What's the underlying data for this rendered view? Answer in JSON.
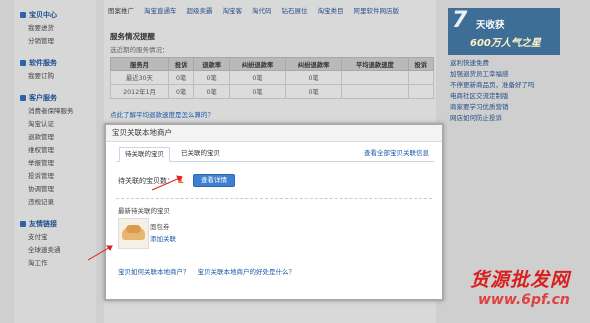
{
  "sidebar": {
    "sections": [
      {
        "title": "宝贝中心",
        "items": [
          "我要进货",
          "分销管理"
        ]
      },
      {
        "title": "软件服务",
        "items": [
          "我要订购"
        ]
      },
      {
        "title": "客户服务",
        "items": [
          "消费者保障服务",
          "淘宝认证",
          "退款管理",
          "维权管理",
          "举报管理",
          "投诉管理",
          "协调管理",
          "违规记录"
        ]
      },
      {
        "title": "友情链接",
        "items": [
          "支付宝",
          "全球速卖通",
          "淘工作"
        ]
      }
    ]
  },
  "main": {
    "tabs": [
      "图案推广",
      "淘宝直通车",
      "超级卖霸",
      "淘宝客",
      "淘代码",
      "钻石展位",
      "淘宝类目",
      "阿里软件网店版"
    ],
    "section_title": "服务情况提醒",
    "section_subtitle": "选近期的服务情况：",
    "table": {
      "headers": [
        "服务月",
        "投诉",
        "退款率",
        "纠纷退款率",
        "纠纷退款率",
        "平均退款速度",
        "投诉"
      ],
      "rows": [
        [
          "最近30天",
          "0笔",
          "0笔",
          "0笔",
          "0笔",
          "",
          ""
        ],
        [
          "2012年1月",
          "0笔",
          "0笔",
          "0笔",
          "0笔",
          "",
          ""
        ]
      ]
    },
    "footer_link": "点此了解平均退款速度是怎么算的？"
  },
  "banner": {
    "big": "7",
    "mid": "天收获",
    "low": "600万人气之星"
  },
  "right_links": [
    "返利快速免费",
    "加强退货员工幸福感",
    "不停更新商品页，准备好了吗",
    "电商社区交流定制版",
    "商家要学习优质营销",
    "网店如何防止投诉"
  ],
  "modal": {
    "title": "宝贝关联本地商户",
    "tab_active": "待关联的宝贝",
    "tab_inactive": "已关联的宝贝",
    "tab_link": "查看全部宝贝关联信息",
    "count_label": "待关联的宝贝数：",
    "count_value": "1",
    "view_button": "查看详情",
    "latest_title": "最新待关联的宝贝",
    "product_name": "面包券",
    "product_link": "添加关联",
    "bottom_link_1": "宝贝如何关联本地商户？",
    "bottom_link_2": "宝贝关联本地商户的好处是什么？"
  },
  "watermark": {
    "line1": "货源批发网",
    "line2": "www.6pf.cn"
  },
  "colors": {
    "accent": "#3f7fd0",
    "count_orange": "#e8741c",
    "watermark_red": "#d91f1f",
    "banner_blue": "#3e6d95"
  }
}
